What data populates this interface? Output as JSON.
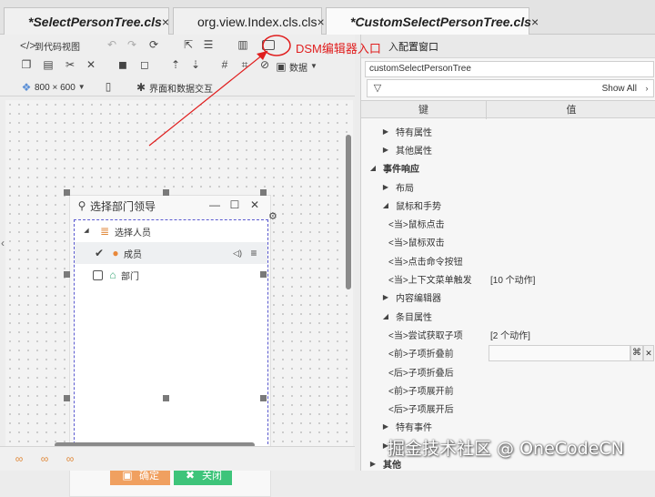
{
  "tabs": [
    {
      "label": "*SelectPersonTree.cls",
      "close": "×",
      "italic": true
    },
    {
      "label": "org.view.Index.cls.cls",
      "close": "×",
      "italic": false
    },
    {
      "label": "*CustomSelectPersonTree.cls",
      "close": "×",
      "italic": true
    }
  ],
  "toolbar": {
    "code_view": "到代码视图",
    "data_label": "数据",
    "resolution": "800 × 600",
    "ui_data_interaction": "界面和数据交互"
  },
  "annotation": {
    "text": "DSM编辑器入口"
  },
  "widget": {
    "title": "选择部门领导",
    "tree_root": "选择人员",
    "member_label": "成员",
    "dept_label": "部门",
    "confirm_label": "确定",
    "close_label": "关闭"
  },
  "props": {
    "header": "配置窗口",
    "header_prefix": "入",
    "name": "customSelectPersonTree",
    "show_all": "Show All",
    "col_key": "键",
    "col_value": "值",
    "rows": [
      {
        "key": "特有属性",
        "arrow": "▶",
        "indent": 1,
        "bold": false,
        "value": ""
      },
      {
        "key": "其他属性",
        "arrow": "▶",
        "indent": 1,
        "bold": false,
        "value": ""
      },
      {
        "key": "事件响应",
        "arrow": "◢",
        "indent": 0,
        "bold": true,
        "value": ""
      },
      {
        "key": "布局",
        "arrow": "▶",
        "indent": 1,
        "bold": false,
        "value": ""
      },
      {
        "key": "鼠标和手势",
        "arrow": "◢",
        "indent": 1,
        "bold": false,
        "value": ""
      },
      {
        "key": "<当>鼠标点击",
        "arrow": "",
        "indent": 2,
        "bold": false,
        "value": ""
      },
      {
        "key": "<当>鼠标双击",
        "arrow": "",
        "indent": 2,
        "bold": false,
        "value": ""
      },
      {
        "key": "<当>点击命令按钮",
        "arrow": "",
        "indent": 2,
        "bold": false,
        "value": ""
      },
      {
        "key": "<当>上下文菜单触发",
        "arrow": "",
        "indent": 2,
        "bold": false,
        "value": "[10 个动作]"
      },
      {
        "key": "内容编辑器",
        "arrow": "▶",
        "indent": 1,
        "bold": false,
        "value": ""
      },
      {
        "key": "条目属性",
        "arrow": "◢",
        "indent": 1,
        "bold": false,
        "value": ""
      },
      {
        "key": "<当>尝试获取子项",
        "arrow": "",
        "indent": 2,
        "bold": false,
        "value": "[2 个动作]"
      },
      {
        "key": "<前>子项折叠前",
        "arrow": "",
        "indent": 2,
        "bold": false,
        "value": "",
        "editor": true
      },
      {
        "key": "<后>子项折叠后",
        "arrow": "",
        "indent": 2,
        "bold": false,
        "value": ""
      },
      {
        "key": "<前>子项展开前",
        "arrow": "",
        "indent": 2,
        "bold": false,
        "value": ""
      },
      {
        "key": "<后>子项展开后",
        "arrow": "",
        "indent": 2,
        "bold": false,
        "value": ""
      },
      {
        "key": "特有事件",
        "arrow": "▶",
        "indent": 1,
        "bold": false,
        "value": ""
      },
      {
        "key": "",
        "arrow": "▶",
        "indent": 1,
        "bold": false,
        "value": ""
      },
      {
        "key": "其他",
        "arrow": "▶",
        "indent": 0,
        "bold": true,
        "value": ""
      }
    ]
  },
  "watermark": "掘金技术社区 @ OneCodeCN",
  "colors": {
    "accent_orange": "#f0a060",
    "accent_green": "#3ec47a",
    "annotation_red": "#e01e1e"
  }
}
